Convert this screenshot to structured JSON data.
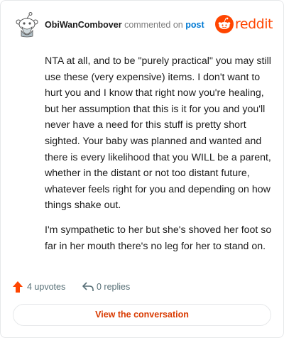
{
  "header": {
    "author": "ObiWanCombover",
    "action_text": "commented on",
    "post_link": "post",
    "brand_wordmark": "reddit"
  },
  "comment": {
    "paragraphs": [
      "NTA at all, and to be \"purely practical\" you may still use these (very expensive) items. I don't want to hurt you and I know that right now you're healing, but her assumption that this is it for you and you'll never have a need for this stuff is pretty short sighted. Your baby was planned and wanted and there is every likelihood that you WILL be a parent, whether in the distant or not too distant future, whatever feels right for you and depending on how things shake out.",
      "I'm sympathetic to her but she's shoved her foot so far in her mouth there's no leg for her to stand on."
    ]
  },
  "actions": {
    "upvotes": "4 upvotes",
    "replies": "0 replies"
  },
  "cta": {
    "label": "View the conversation"
  },
  "colors": {
    "brand": "#ff4500",
    "upvote": "#ff4500",
    "link": "#0079d3",
    "cta_text": "#d93a00",
    "muted": "#576f76"
  },
  "icons": {
    "avatar": "snoo-avatar-icon",
    "brand": "reddit-logo-icon",
    "upvote": "upvote-arrow-icon",
    "reply": "reply-arrow-icon"
  }
}
